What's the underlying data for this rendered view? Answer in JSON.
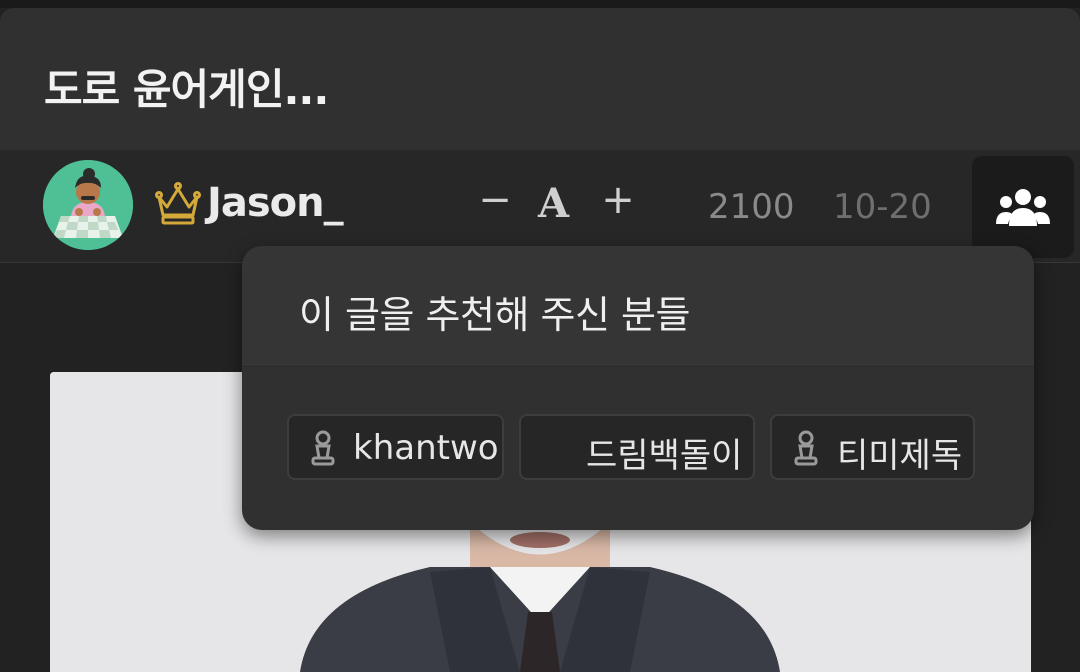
{
  "post": {
    "title": "도로 윤어게인...",
    "author": "Jason_",
    "views": "2100",
    "date": "10-20"
  },
  "font_controls": {
    "decrease": "−",
    "letter": "A",
    "increase": "+"
  },
  "popup": {
    "title": "이 글을 추천해 주신 분들",
    "recommenders": [
      {
        "name": "khantwo",
        "icon": "pawn-icon"
      },
      {
        "name": "드림백돌이",
        "icon": ""
      },
      {
        "name": "티미제독",
        "icon": "pawn-icon"
      }
    ]
  },
  "colors": {
    "background": "#222222",
    "title_bar": "#303030",
    "crown": "#d4a93a",
    "avatar_bg": "#4fbf96"
  },
  "icons": {
    "crown": "crown-icon",
    "recommenders_button": "people-group-icon",
    "avatar": "chess-avatar"
  }
}
